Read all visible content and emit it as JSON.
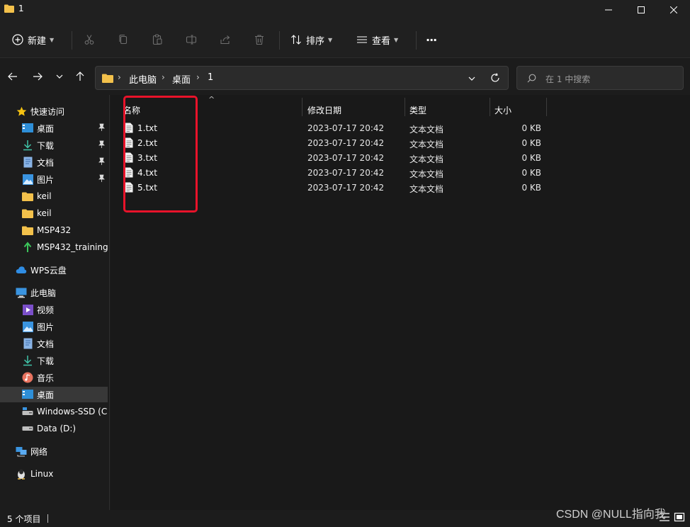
{
  "window": {
    "title": "1"
  },
  "toolbar": {
    "new_label": "新建",
    "sort_label": "排序",
    "view_label": "查看",
    "more_label": "···"
  },
  "address": {
    "breadcrumbs": [
      "此电脑",
      "桌面",
      "1"
    ]
  },
  "search": {
    "placeholder": "在 1 中搜索"
  },
  "sidebar": {
    "quick_access": {
      "label": "快速访问",
      "items": [
        {
          "label": "桌面",
          "icon": "desktop-icon",
          "pinned": true
        },
        {
          "label": "下载",
          "icon": "download-icon",
          "pinned": true
        },
        {
          "label": "文档",
          "icon": "document-icon",
          "pinned": true
        },
        {
          "label": "图片",
          "icon": "picture-icon",
          "pinned": true
        },
        {
          "label": "keil",
          "icon": "folder-icon"
        },
        {
          "label": "keil",
          "icon": "folder-icon"
        },
        {
          "label": "MSP432",
          "icon": "folder-icon"
        },
        {
          "label": "MSP432_training",
          "icon": "sync-folder-icon"
        }
      ]
    },
    "wps": {
      "label": "WPS云盘"
    },
    "this_pc": {
      "label": "此电脑",
      "items": [
        {
          "label": "视频",
          "icon": "video-icon"
        },
        {
          "label": "图片",
          "icon": "picture-icon"
        },
        {
          "label": "文档",
          "icon": "document-icon"
        },
        {
          "label": "下载",
          "icon": "download-icon"
        },
        {
          "label": "音乐",
          "icon": "music-icon"
        },
        {
          "label": "桌面",
          "icon": "desktop-icon",
          "selected": true
        },
        {
          "label": "Windows-SSD (C:",
          "icon": "drive-icon"
        },
        {
          "label": "Data (D:)",
          "icon": "drive-icon"
        }
      ]
    },
    "network": {
      "label": "网络"
    },
    "linux": {
      "label": "Linux"
    }
  },
  "columns": {
    "name": "名称",
    "date": "修改日期",
    "type": "类型",
    "size": "大小"
  },
  "files": [
    {
      "name": "1.txt",
      "date": "2023-07-17 20:42",
      "type": "文本文档",
      "size": "0 KB"
    },
    {
      "name": "2.txt",
      "date": "2023-07-17 20:42",
      "type": "文本文档",
      "size": "0 KB"
    },
    {
      "name": "3.txt",
      "date": "2023-07-17 20:42",
      "type": "文本文档",
      "size": "0 KB"
    },
    {
      "name": "4.txt",
      "date": "2023-07-17 20:42",
      "type": "文本文档",
      "size": "0 KB"
    },
    {
      "name": "5.txt",
      "date": "2023-07-17 20:42",
      "type": "文本文档",
      "size": "0 KB"
    }
  ],
  "status": {
    "item_count": "5 个项目"
  },
  "watermark": "CSDN @NULL指向我",
  "colors": {
    "highlight": "#e8132a",
    "folder": "#f3c14b",
    "accent": "#60cdff"
  }
}
